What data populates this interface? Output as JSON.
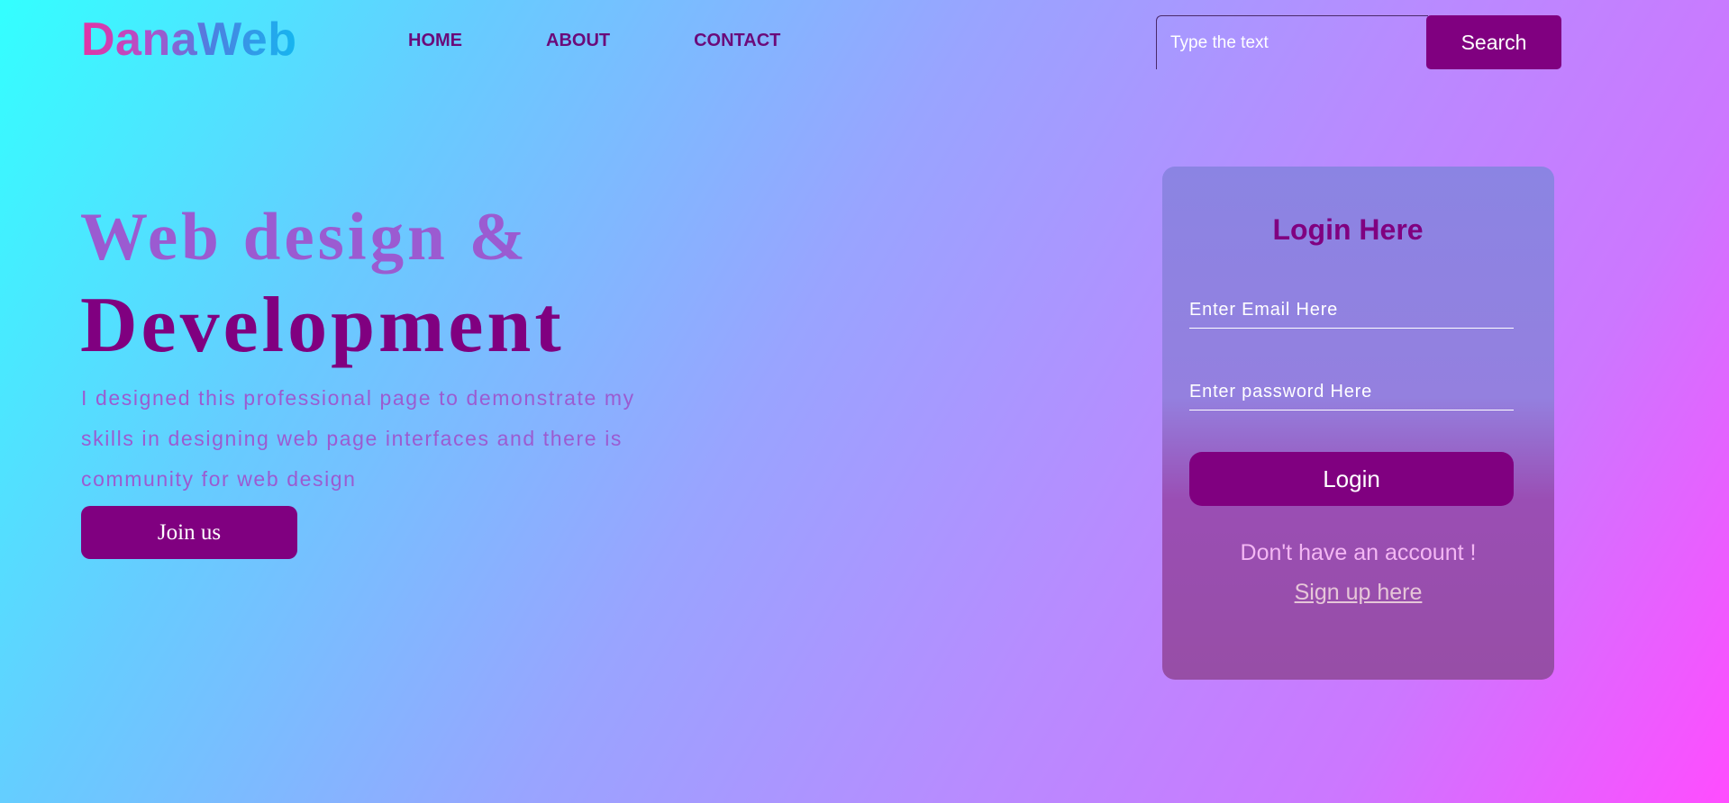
{
  "header": {
    "logo": "DanaWeb",
    "nav": [
      "HOME",
      "ABOUT",
      "CONTACT"
    ],
    "search": {
      "placeholder": "Type the text",
      "button_label": "Search"
    }
  },
  "hero": {
    "title_line1": "Web design &",
    "title_line2": "Development",
    "description": "I designed this professional page to demonstrate my skills in designing web page interfaces and there is community for web design",
    "join_label": "Join us"
  },
  "login": {
    "title": "Login Here",
    "email_placeholder": "Enter Email Here",
    "password_placeholder": "Enter password Here",
    "button_label": "Login",
    "no_account_text": "Don't have an account !",
    "signup_label": "Sign up here"
  },
  "colors": {
    "primary": "#800080",
    "accent_light": "#9b5bd1"
  }
}
